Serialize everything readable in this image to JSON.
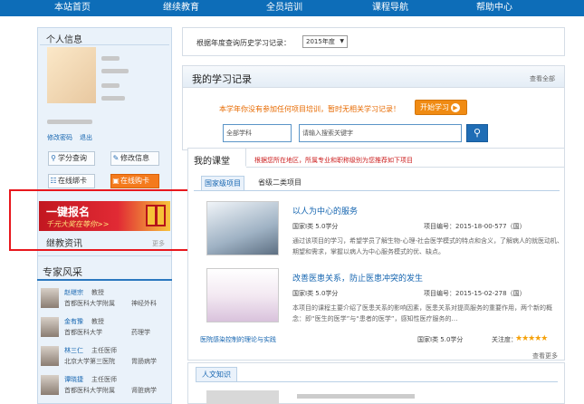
{
  "topnav": {
    "items": [
      "本站首页",
      "继续教育",
      "全员培训",
      "课程导航",
      "帮助中心"
    ]
  },
  "sidebar": {
    "personal_title": "个人信息",
    "links": [
      "修改密码",
      "退出"
    ],
    "buttons": [
      {
        "label": "学分查询",
        "icon": "search-icon"
      },
      {
        "label": "修改信息",
        "icon": "edit-icon"
      },
      {
        "label": "在线绑卡",
        "icon": "card-icon"
      },
      {
        "label": "在线购卡",
        "icon": "cart-icon"
      }
    ],
    "banner": {
      "title": "一键报名",
      "subtitle": "千元大奖在等你>>"
    },
    "news_title": "继教资讯",
    "news_more": "更多",
    "experts_title": "专家风采",
    "experts": [
      {
        "name": "赵继宗",
        "title": "教授",
        "org": "首都医科大学附属",
        "dept": "神经外科"
      },
      {
        "name": "金有豫",
        "title": "教授",
        "org": "首都医科大学",
        "dept": "药理学"
      },
      {
        "name": "林三仁",
        "title": "主任医师",
        "org": "北京大学第三医院",
        "dept": "胃肠病学"
      },
      {
        "name": "谭晓捷",
        "title": "主任医师",
        "org": "首都医科大学附属",
        "dept": "肾脏病学"
      }
    ]
  },
  "year_query": {
    "label": "根据年度查询历史学习记录：",
    "selected": "2015年度"
  },
  "records": {
    "title": "我的学习记录",
    "more": "查看全部",
    "message": "本学年你没有参加任何项目培训，暂时无相关学习记录！",
    "start_button": "开始学习"
  },
  "search": {
    "subject_placeholder": "全部学科",
    "keyword_placeholder": "请输入搜索关键字"
  },
  "my_course": {
    "tab": "我的课堂",
    "note": "根据您所在地区，所属专业和职称级别为您推荐如下项目",
    "subtabs": [
      "国家级项目",
      "省级二类项目"
    ],
    "courses": [
      {
        "title": "以人为中心的服务",
        "credit": "国家I类 5.0学分",
        "code": "项目编号：2015-18-00-577（国）",
        "desc": "通过该项目的学习，希望学员了解生物-心理-社会医学模式的特点和含义，了解病人的就医动机、期望和需求，掌握以病人为中心服务模式的优、缺点。"
      },
      {
        "title": "改善医患关系，防止医患冲突的发生",
        "credit": "国家I类 5.0学分",
        "code": "项目编号：2015-15-02-278（国）",
        "desc": "本项目的课程主要介绍了医患关系的影响因素，医患关系对提高服务的重要作用，两个新的概念：即“医生的医学”与“患者的医学”，感知性医疗服务的…"
      }
    ],
    "extra_course": {
      "title": "医院感染控制的理论与实践",
      "credit": "国家I类 5.0学分",
      "follow": "关注度："
    },
    "rating": 5,
    "more": "查看更多"
  },
  "humanities": {
    "tab": "人文知识"
  }
}
